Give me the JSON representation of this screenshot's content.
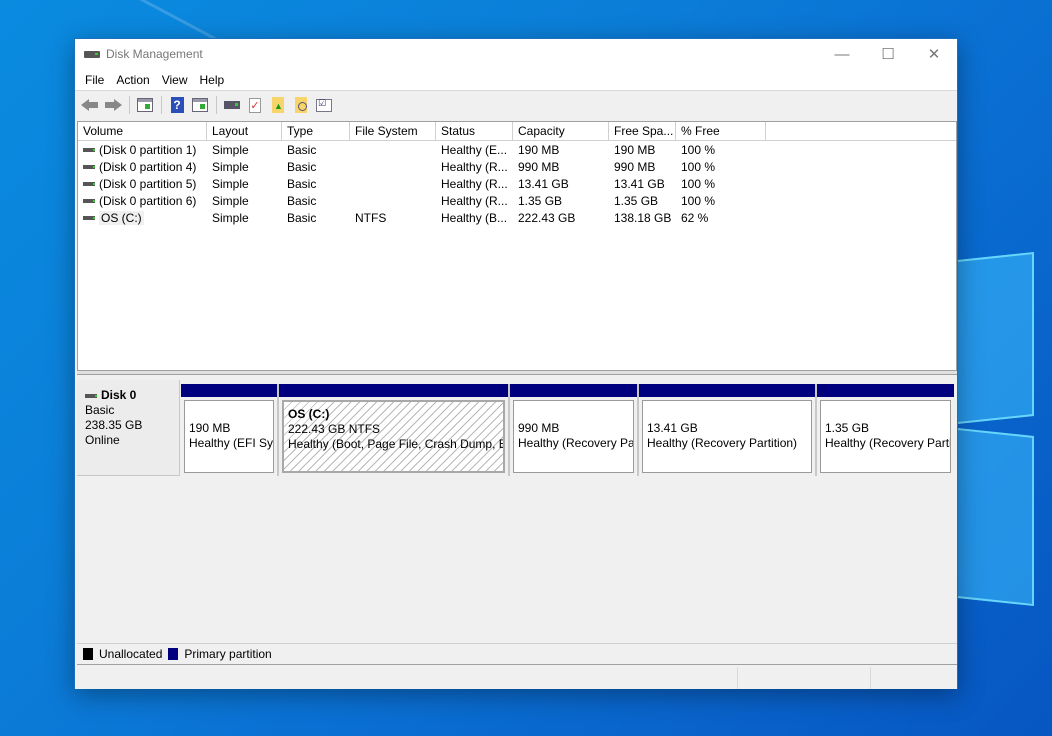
{
  "window": {
    "title": "Disk Management",
    "controls": {
      "minimize": "—",
      "maximize": "☐",
      "close": "✕"
    }
  },
  "menubar": [
    "File",
    "Action",
    "View",
    "Help"
  ],
  "toolbar": [
    {
      "icon": "back-arrow-icon"
    },
    {
      "icon": "forward-arrow-icon"
    },
    {
      "icon": "show-hide-console-tree-icon"
    },
    {
      "icon": "help-icon"
    },
    {
      "icon": "show-hide-action-pane-icon"
    },
    {
      "icon": "connect-disk-icon"
    },
    {
      "icon": "properties-check-icon"
    },
    {
      "icon": "open-folder-up-icon"
    },
    {
      "icon": "explore-folder-icon"
    },
    {
      "icon": "settings-list-icon"
    }
  ],
  "volume_table": {
    "columns": [
      "Volume",
      "Layout",
      "Type",
      "File System",
      "Status",
      "Capacity",
      "Free Spa...",
      "% Free",
      ""
    ],
    "rows": [
      {
        "volume": "(Disk 0 partition 1)",
        "layout": "Simple",
        "type": "Basic",
        "fs": "",
        "status": "Healthy (E...",
        "capacity": "190 MB",
        "free": "190 MB",
        "pct": "100 %"
      },
      {
        "volume": "(Disk 0 partition 4)",
        "layout": "Simple",
        "type": "Basic",
        "fs": "",
        "status": "Healthy (R...",
        "capacity": "990 MB",
        "free": "990 MB",
        "pct": "100 %"
      },
      {
        "volume": "(Disk 0 partition 5)",
        "layout": "Simple",
        "type": "Basic",
        "fs": "",
        "status": "Healthy (R...",
        "capacity": "13.41 GB",
        "free": "13.41 GB",
        "pct": "100 %"
      },
      {
        "volume": "(Disk 0 partition 6)",
        "layout": "Simple",
        "type": "Basic",
        "fs": "",
        "status": "Healthy (R...",
        "capacity": "1.35 GB",
        "free": "1.35 GB",
        "pct": "100 %"
      },
      {
        "volume": "OS (C:)",
        "layout": "Simple",
        "type": "Basic",
        "fs": "NTFS",
        "status": "Healthy (B...",
        "capacity": "222.43 GB",
        "free": "138.18 GB",
        "pct": "62 %"
      }
    ]
  },
  "disk": {
    "name": "Disk 0",
    "type": "Basic",
    "size": "238.35 GB",
    "status": "Online",
    "partitions": [
      {
        "title": "",
        "size": "190 MB",
        "status": "Healthy (EFI Sys"
      },
      {
        "title": "OS  (C:)",
        "size": "222.43 GB NTFS",
        "status": "Healthy (Boot, Page File, Crash Dump, Ba",
        "selected": true
      },
      {
        "title": "",
        "size": "990 MB",
        "status": "Healthy (Recovery Pa"
      },
      {
        "title": "",
        "size": "13.41 GB",
        "status": "Healthy (Recovery Partition)"
      },
      {
        "title": "",
        "size": "1.35 GB",
        "status": "Healthy (Recovery Parti"
      }
    ]
  },
  "legend": [
    {
      "label": "Unallocated",
      "color": "#000000"
    },
    {
      "label": "Primary partition",
      "color": "#00007f"
    }
  ],
  "colors": {
    "primary_partition": "#00007f",
    "unallocated": "#000000"
  }
}
